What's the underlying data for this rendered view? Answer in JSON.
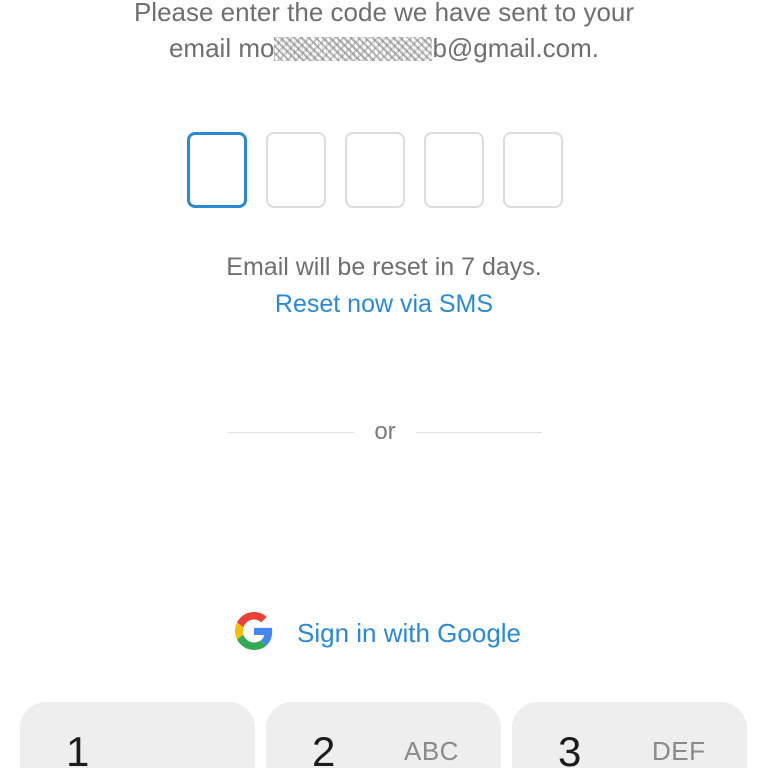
{
  "instructions": {
    "line1": "Please enter the code we have sent to your",
    "email_prefix": "email mo",
    "email_suffix": "b@gmail.com."
  },
  "code": {
    "length": 5,
    "active_index": 0,
    "accent_color": "#2a8ad4"
  },
  "reset": {
    "message": "Email will be reset in 7 days.",
    "link_label": "Reset now via SMS"
  },
  "divider": {
    "label": "or"
  },
  "google": {
    "label": "Sign in with Google",
    "icon": "google-g-icon"
  },
  "keypad": {
    "keys": [
      {
        "digit": "1",
        "letters": ""
      },
      {
        "digit": "2",
        "letters": "ABC"
      },
      {
        "digit": "3",
        "letters": "DEF"
      }
    ]
  }
}
